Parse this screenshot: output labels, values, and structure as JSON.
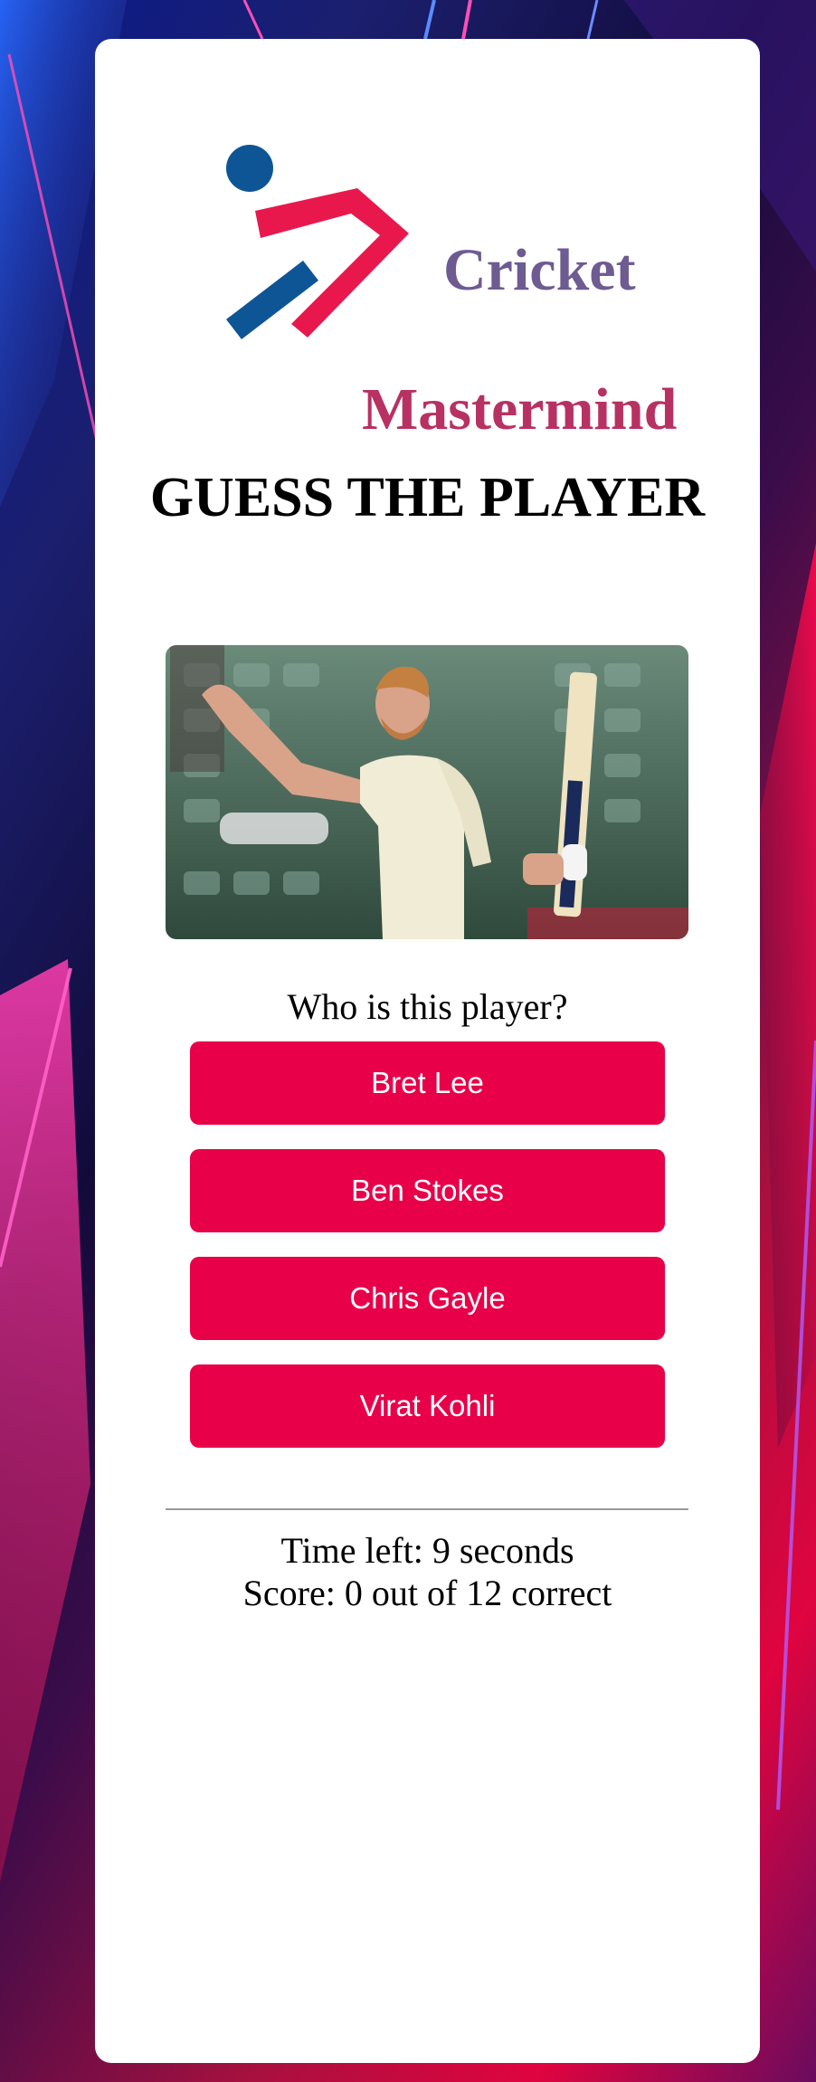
{
  "logo": {
    "word_1": "Cricket",
    "word_2": "Mastermind",
    "icon": "cricket-player-logo-icon",
    "colors": {
      "ball": "#0e5596",
      "bat": "#0e5596",
      "body": "#e8184d",
      "word_1": "#6e5b92",
      "word_2": "#b83163"
    }
  },
  "game": {
    "title": "GUESS THE PLAYER",
    "image_icon": "cricket-player-photo",
    "question": "Who is this player?",
    "options": [
      "Bret Lee",
      "Ben Stokes",
      "Chris Gayle",
      "Virat Kohli"
    ],
    "time_left": "Time left: 9 seconds",
    "score": "Score: 0 out of 12 correct"
  },
  "colors": {
    "button_bg": "#e80048",
    "button_text": "#ffffff",
    "card_bg": "#ffffff",
    "divider": "#9a9a9a"
  }
}
